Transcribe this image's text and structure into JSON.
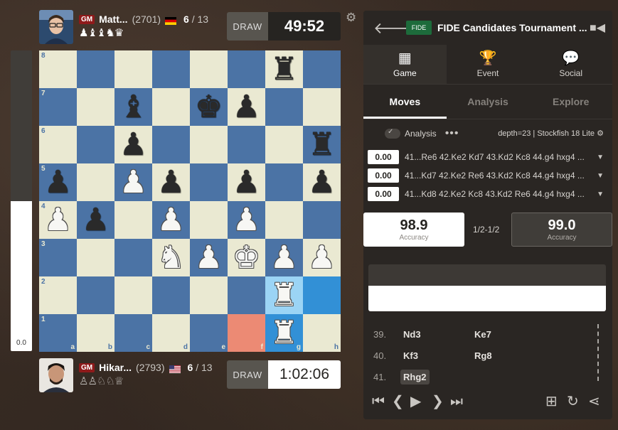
{
  "top_player": {
    "title": "GM",
    "name": "Matt...",
    "rating": "(2701)",
    "score": "6",
    "score_total": "/ 13",
    "captured": "♟♝♝♞♛",
    "clock_draw": "DRAW",
    "clock_time": "49:52",
    "flag": "germany"
  },
  "bottom_player": {
    "title": "GM",
    "name": "Hikar...",
    "rating": "(2793)",
    "score": "6",
    "score_total": "/ 13",
    "captured": "♙♙♘♘♕",
    "clock_draw": "DRAW",
    "clock_time": "1:02:06",
    "flag": "usa"
  },
  "eval": {
    "text": "0.0",
    "white_share": 0.5
  },
  "board": {
    "files": [
      "a",
      "b",
      "c",
      "d",
      "e",
      "f",
      "g",
      "h"
    ],
    "ranks": [
      "8",
      "7",
      "6",
      "5",
      "4",
      "3",
      "2",
      "1"
    ],
    "highlight_squares": {
      "g2": "hl",
      "h2": "hl",
      "f1": "hl-red",
      "g1": "hl"
    },
    "pieces": {
      "g8": "bR",
      "c7": "bB",
      "e7": "bK",
      "f7": "bP",
      "c6": "bP",
      "h6": "bR",
      "a5": "bP",
      "c5": "wP",
      "d5": "bP",
      "f5": "bP",
      "h5": "bP",
      "a4": "wP",
      "b4": "bP",
      "d4": "wP",
      "f4": "wP",
      "d3": "wN",
      "e3": "wP",
      "f3": "wK",
      "g3": "wP",
      "h3": "wP",
      "g2": "wR",
      "g1": "wR"
    }
  },
  "panel": {
    "event_logo": "FIDE",
    "event_title": "FIDE Candidates Tournament ...",
    "main_tabs": [
      {
        "label": "Game",
        "icon": "▦",
        "active": true
      },
      {
        "label": "Event",
        "icon": "🏆",
        "active": false
      },
      {
        "label": "Social",
        "icon": "💬",
        "active": false
      }
    ],
    "sub_tabs": [
      {
        "label": "Moves",
        "active": true
      },
      {
        "label": "Analysis",
        "active": false
      },
      {
        "label": "Explore",
        "active": false
      }
    ],
    "analysis_label": "Analysis",
    "dots": "•••",
    "depth": "depth=23 | Stockfish 18 Lite",
    "lines": [
      {
        "score": "0.00",
        "text": "41...Re6 42.Ke2 Kd7 43.Kd2 Kc8 44.g4 hxg4 ..."
      },
      {
        "score": "0.00",
        "text": "41...Kd7 42.Ke2 Re6 43.Kd2 Kc8 44.g4 hxg4 ..."
      },
      {
        "score": "0.00",
        "text": "41...Kd8 42.Ke2 Kc8 43.Kd2 Re6 44.g4 hxg4 ..."
      }
    ],
    "accuracy_white": "98.9",
    "accuracy_black": "99.0",
    "accuracy_label": "Accuracy",
    "result": "1/2-1/2",
    "moves": [
      {
        "num": "39.",
        "white": "Nd3",
        "black": "Ke7"
      },
      {
        "num": "40.",
        "white": "Kf3",
        "black": "Rg8"
      },
      {
        "num": "41.",
        "white": "Rhg2",
        "black": ""
      }
    ]
  }
}
